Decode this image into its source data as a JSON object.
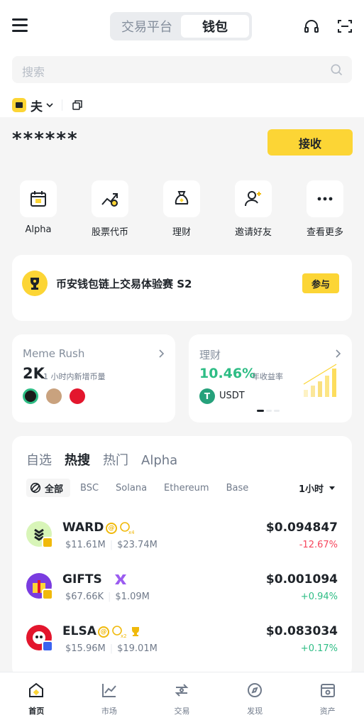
{
  "header": {
    "tabs": [
      {
        "label": "交易平台",
        "active": false
      },
      {
        "label": "钱包",
        "active": true
      }
    ],
    "icons": [
      "menu-icon",
      "headset-icon",
      "scan-icon"
    ]
  },
  "search": {
    "placeholder": "搜索"
  },
  "wallet": {
    "name": "夫",
    "balance": "******",
    "receive_label": "接收"
  },
  "quick_actions": [
    {
      "label": "Alpha",
      "icon": "alpha-calendar-icon"
    },
    {
      "label": "股票代币",
      "icon": "stock-token-icon"
    },
    {
      "label": "理财",
      "icon": "money-bag-icon"
    },
    {
      "label": "邀请好友",
      "icon": "invite-friend-icon"
    },
    {
      "label": "查看更多",
      "icon": "more-icon"
    }
  ],
  "event": {
    "title": "币安钱包链上交易体验赛 S2",
    "button": "参与"
  },
  "meme_rush": {
    "title": "Meme Rush",
    "count": "2K",
    "sub": "1 小时内新增币量"
  },
  "earn": {
    "title": "理财",
    "rate": "10.46%",
    "rate_label": "年收益率",
    "asset": "USDT"
  },
  "market": {
    "tabs": [
      {
        "label": "自选",
        "active": false
      },
      {
        "label": "热搜",
        "active": true
      },
      {
        "label": "热门",
        "active": false
      },
      {
        "label": "Alpha",
        "active": false
      }
    ],
    "chains": [
      "全部",
      "BSC",
      "Solana",
      "Ethereum",
      "Base"
    ],
    "time_filter": "1小时",
    "tokens": [
      {
        "name": "WARD",
        "market_cap": "$11.61M",
        "volume": "$23.74M",
        "price": "$0.094847",
        "change": "-12.67%",
        "direction": "down"
      },
      {
        "name": "GIFTS",
        "market_cap": "$67.66K",
        "volume": "$1.09M",
        "price": "$0.001094",
        "change": "+0.94%",
        "direction": "up"
      },
      {
        "name": "ELSA",
        "market_cap": "$15.96M",
        "volume": "$19.01M",
        "price": "$0.083034",
        "change": "+0.17%",
        "direction": "up"
      }
    ]
  },
  "bottom_nav": [
    {
      "label": "首页",
      "active": true
    },
    {
      "label": "市场",
      "active": false
    },
    {
      "label": "交易",
      "active": false
    },
    {
      "label": "发现",
      "active": false
    },
    {
      "label": "资产",
      "active": false
    }
  ],
  "colors": {
    "brand_yellow": "#fcd535",
    "up": "#2ebd85",
    "down": "#f6465d",
    "text": "#1e2329"
  }
}
